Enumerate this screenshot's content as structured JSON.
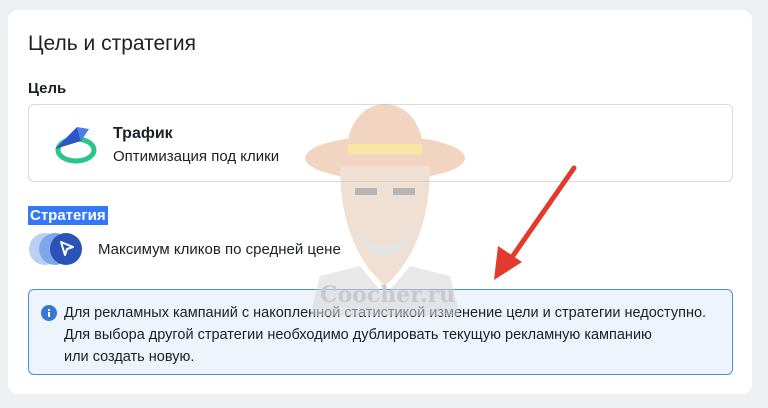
{
  "section": {
    "title": "Цель и стратегия"
  },
  "goal": {
    "label": "Цель",
    "option_title": "Трафик",
    "option_subtitle": "Оптимизация под клики",
    "icon": "traffic-arrow-icon"
  },
  "strategy": {
    "label": "Стратегия",
    "value": "Максимум кликов по средней цене",
    "icon": "cursor-click-icon"
  },
  "info": {
    "icon": "info-icon",
    "line1": "Для рекламных кампаний с накопленной статистикой изменение цели и стратегии недоступно.",
    "line2": "Для выбора другой стратегии необходимо дублировать текущую рекламную кампанию",
    "line3": "или создать новую."
  },
  "watermark": {
    "text": "Coocher.ru"
  },
  "colors": {
    "accent": "#3478f6",
    "info_border": "#4b8fd9",
    "info_bg": "#eef4fc",
    "annotation_arrow": "#e23a2c"
  }
}
